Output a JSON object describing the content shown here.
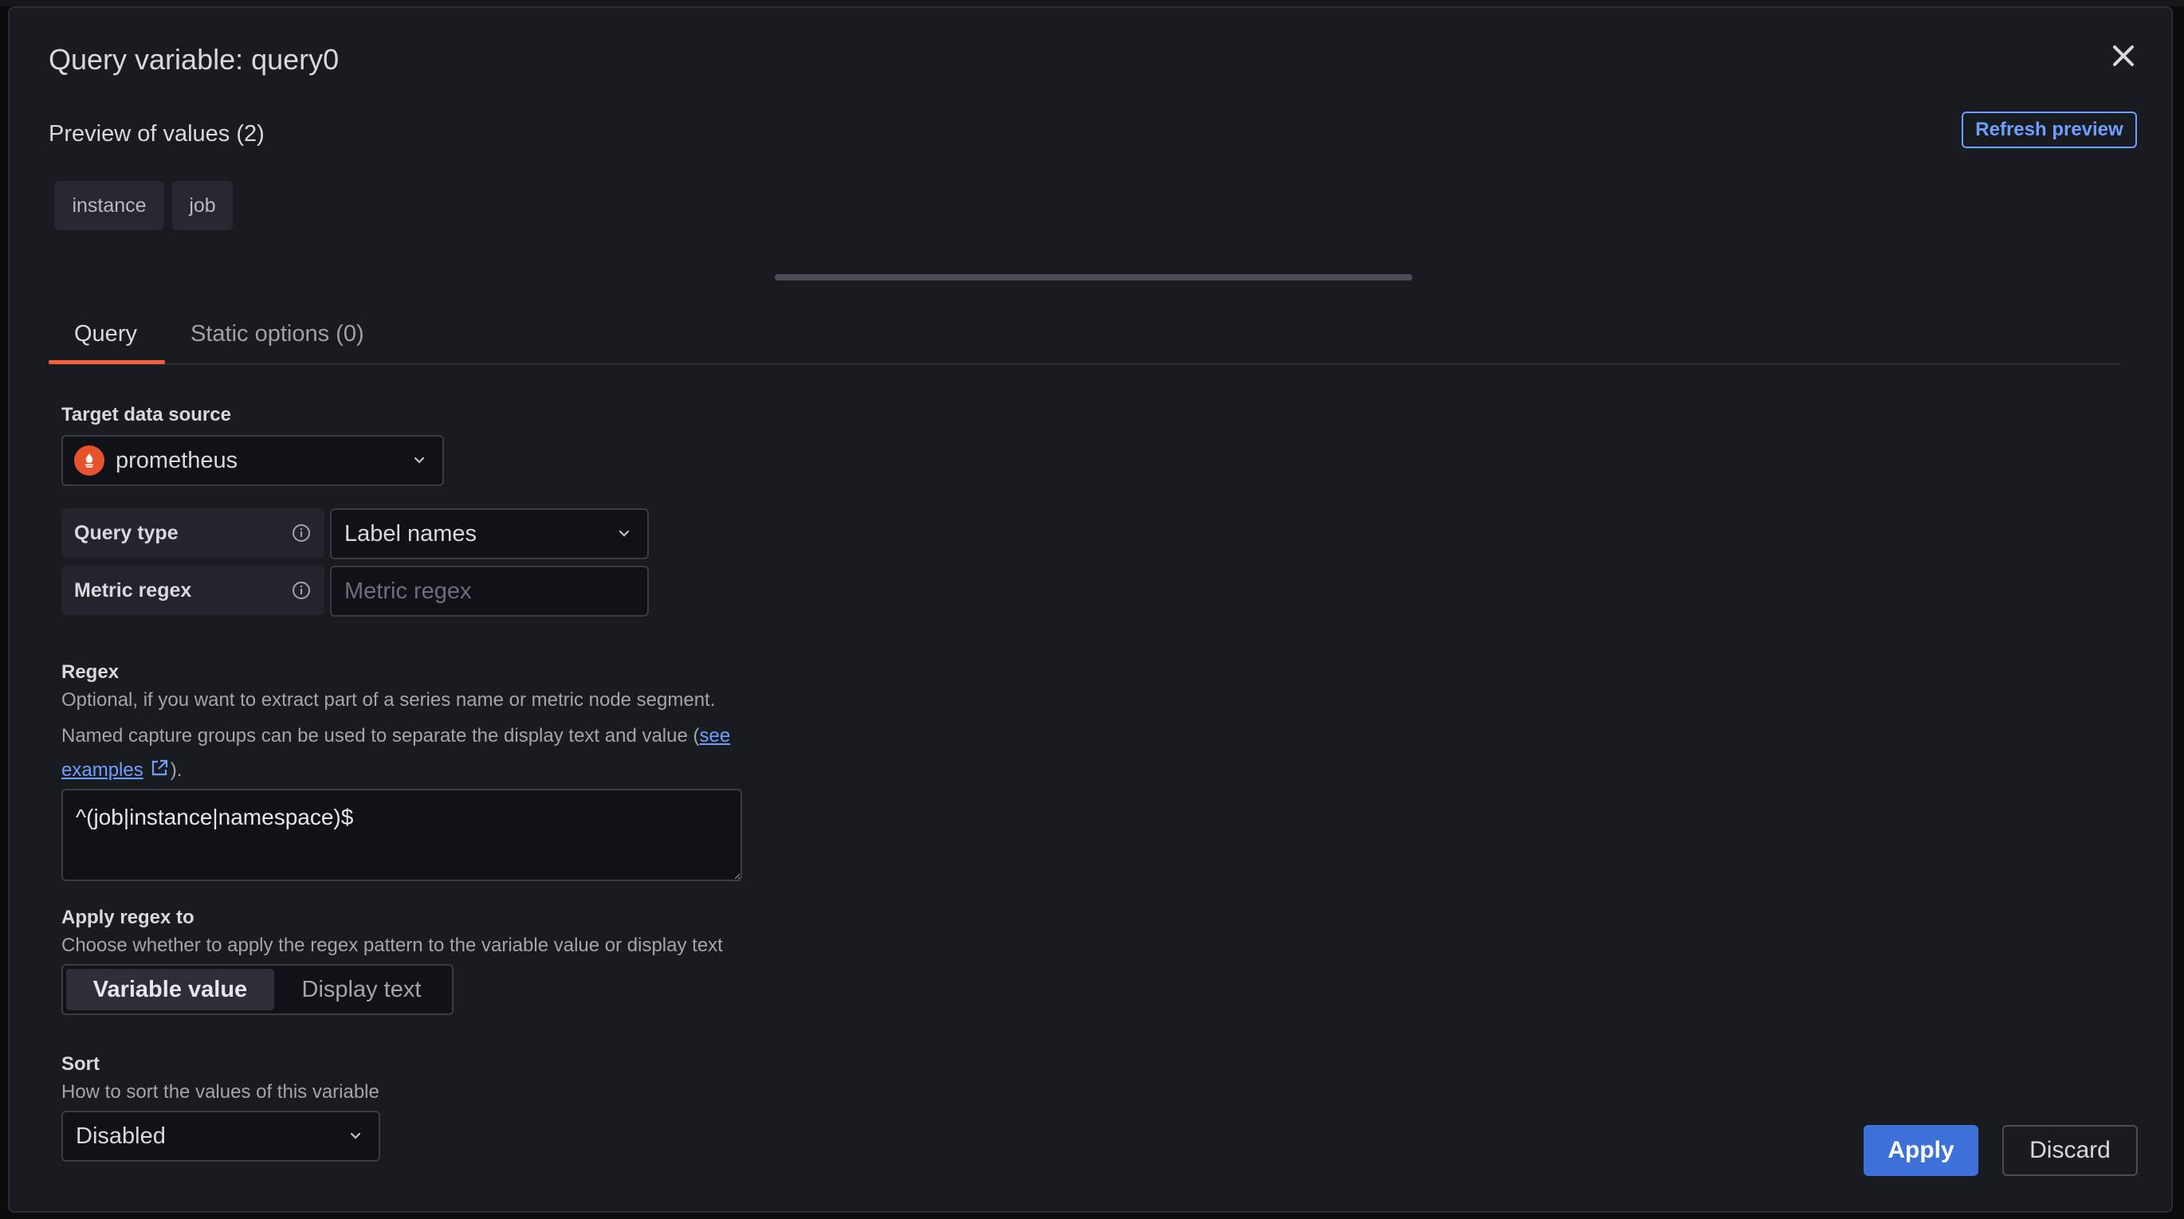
{
  "modal": {
    "title": "Query variable: query0",
    "close_icon": "close-icon"
  },
  "preview": {
    "title": "Preview of values (2)",
    "refresh_label": "Refresh preview",
    "values": [
      "instance",
      "job"
    ]
  },
  "tabs": [
    {
      "label": "Query",
      "active": true
    },
    {
      "label": "Static options (0)",
      "active": false
    }
  ],
  "datasource": {
    "label": "Target data source",
    "value": "prometheus",
    "icon": "prometheus-logo-icon",
    "brand_color": "#e6522c"
  },
  "query_type": {
    "label": "Query type",
    "value": "Label names"
  },
  "metric_regex": {
    "label": "Metric regex",
    "placeholder": "Metric regex",
    "value": ""
  },
  "regex": {
    "label": "Regex",
    "desc1": "Optional, if you want to extract part of a series name or metric node segment.",
    "desc2_pre": "Named capture groups can be used to separate the display text and value (",
    "link_text1": "see",
    "link_text2": "examples",
    "desc2_post": ").",
    "value": "^(job|instance|namespace)$"
  },
  "apply_regex": {
    "label": "Apply regex to",
    "desc": "Choose whether to apply the regex pattern to the variable value or display text",
    "options": [
      "Variable value",
      "Display text"
    ],
    "selected": "Variable value"
  },
  "sort": {
    "label": "Sort",
    "desc": "How to sort the values of this variable",
    "value": "Disabled"
  },
  "footer": {
    "apply_label": "Apply",
    "discard_label": "Discard"
  },
  "colors": {
    "accent": "#6e9fff",
    "primary_button": "#3d71d9",
    "tab_active": "#f55f3e",
    "background": "#181b1f"
  }
}
